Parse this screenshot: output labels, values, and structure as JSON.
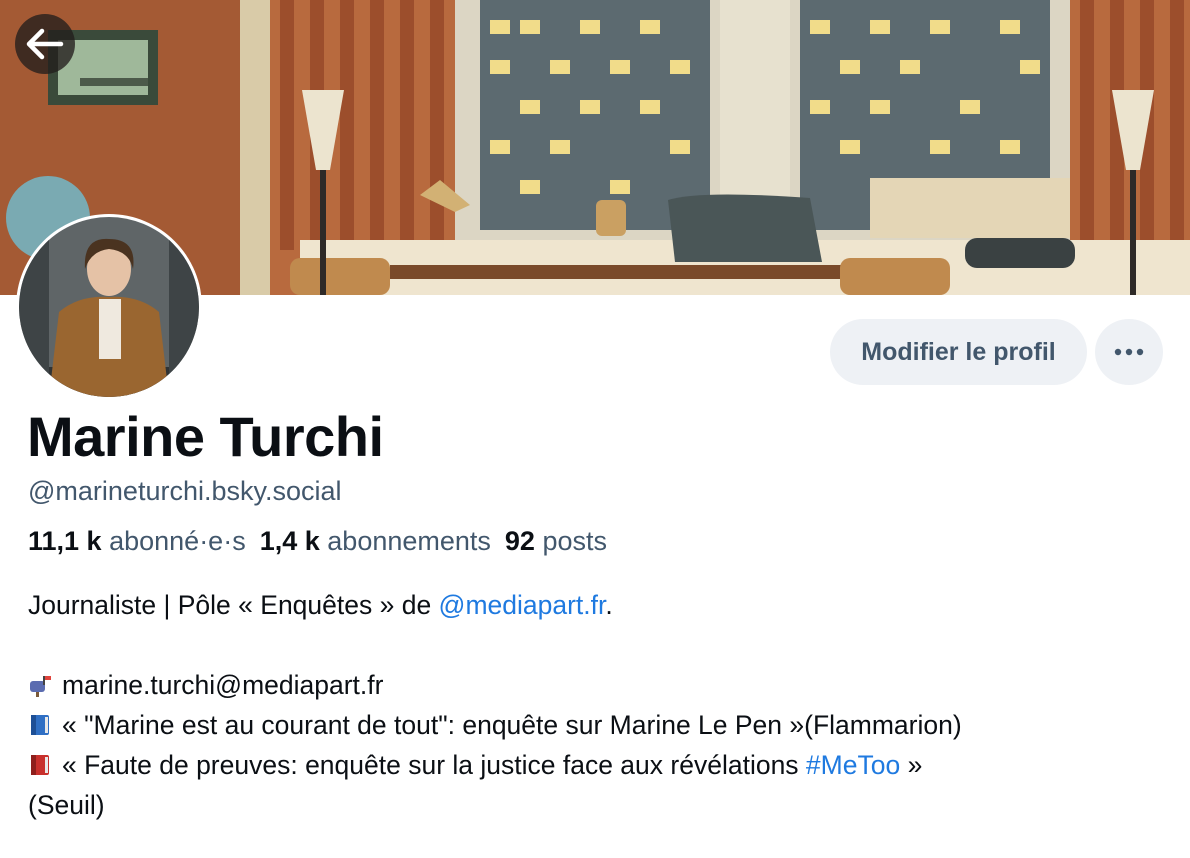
{
  "navigation": {
    "back_icon": "arrow-left-icon"
  },
  "profile": {
    "name": "Marine Turchi",
    "handle": "@marineturchi.bsky.social",
    "stats": {
      "followers_count": "11,1 k",
      "followers_label": "abonné·e·s",
      "following_count": "1,4 k",
      "following_label": "abonnements",
      "posts_count": "92",
      "posts_label": "posts"
    }
  },
  "actions": {
    "edit_label": "Modifier le profil",
    "more_icon": "more-horizontal-icon"
  },
  "bio": {
    "line1_prefix": "Journaliste | Pôle « Enquêtes » de ",
    "line1_link": "@mediapart.fr",
    "line1_suffix": ".",
    "email_icon": "mailbox-icon",
    "email": "marine.turchi@mediapart.fr",
    "book1_icon": "blue-book-icon",
    "book1": "« \"Marine est au courant de tout\": enquête sur Marine Le Pen »(Flammarion)",
    "book2_icon": "red-book-icon",
    "book2_prefix": "« Faute de preuves: enquête sur la justice face aux révélations ",
    "book2_hashtag": "#MeToo",
    "book2_suffix": " »",
    "book2_line2": "(Seuil)"
  },
  "colors": {
    "link": "#1f7ae0",
    "muted_text": "#42576c",
    "button_bg": "#eef1f5"
  }
}
